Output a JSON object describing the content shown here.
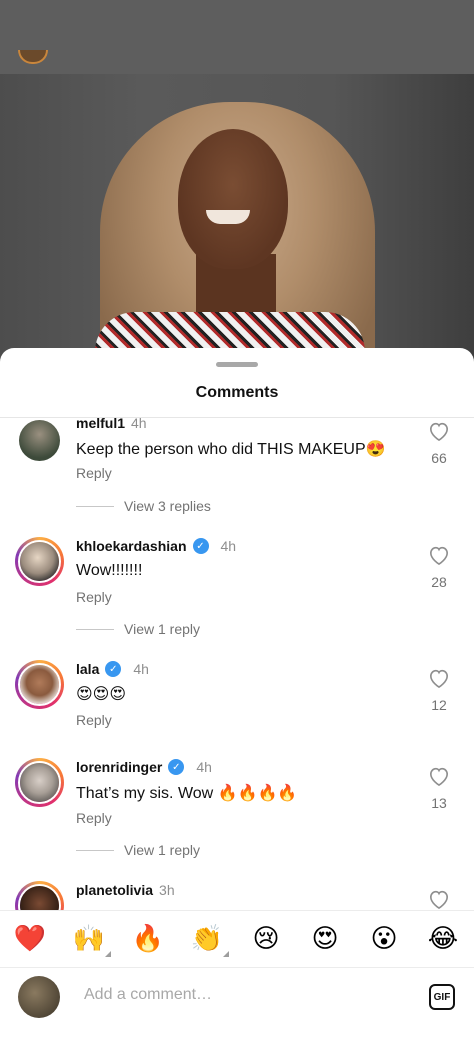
{
  "sheet": {
    "title": "Comments"
  },
  "comments": [
    {
      "username": "melful1",
      "verified": false,
      "time": "4h",
      "text": "Keep the person who did THIS MAKEUP😍",
      "reply": "Reply",
      "likes": "66",
      "view_replies": "View 3 replies"
    },
    {
      "username": "khloekardashian",
      "verified": true,
      "time": "4h",
      "text": "Wow!!!!!!!",
      "reply": "Reply",
      "likes": "28",
      "view_replies": "View 1 reply"
    },
    {
      "username": "lala",
      "verified": true,
      "time": "4h",
      "text": "😍😍😍",
      "reply": "Reply",
      "likes": "12"
    },
    {
      "username": "lorenridinger",
      "verified": true,
      "time": "4h",
      "text": "That’s my sis. Wow 🔥🔥🔥🔥",
      "reply": "Reply",
      "likes": "13",
      "view_replies": "View 1 reply"
    },
    {
      "username": "planetolivia",
      "verified": false,
      "time": "3h"
    }
  ],
  "emoji_bar": [
    "❤️",
    "🙌",
    "🔥",
    "👏",
    "😢",
    "😍",
    "😮",
    "😂"
  ],
  "compose": {
    "placeholder": "Add a comment…",
    "gif_label": "GIF"
  },
  "colors": {
    "verified": "#3897f0",
    "story_ring": "#e1306c",
    "muted_text": "#737373"
  }
}
